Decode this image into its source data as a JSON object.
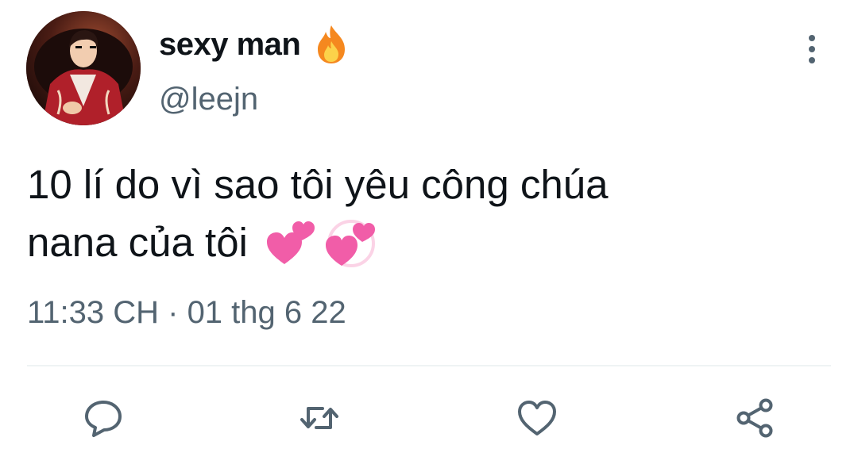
{
  "tweet": {
    "author": {
      "display_name": "sexy man",
      "name_emoji": "fire-emoji",
      "handle": "@leejn"
    },
    "text_lines": [
      "10 lí do vì sao tôi yêu công chúa",
      "nana của tôi"
    ],
    "text_emojis": [
      "two-hearts-emoji",
      "revolving-hearts-emoji"
    ],
    "timestamp": "11:33 CH · 01 thg 6 22"
  },
  "actions": [
    {
      "name": "reply",
      "icon": "reply-icon"
    },
    {
      "name": "retweet",
      "icon": "retweet-icon"
    },
    {
      "name": "like",
      "icon": "heart-icon"
    },
    {
      "name": "share",
      "icon": "share-icon"
    }
  ],
  "colors": {
    "text_primary": "#0f1419",
    "text_secondary": "#536471",
    "divider": "#eff3f4",
    "heart_pink": "#f15da8"
  }
}
